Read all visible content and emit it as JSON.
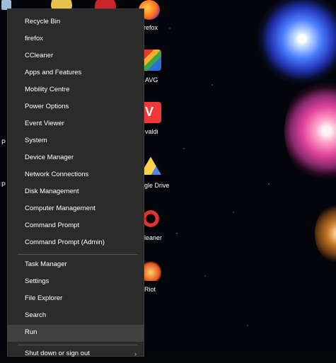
{
  "desktop": {
    "icons": [
      {
        "name": "recycle-bin-icon",
        "label": ""
      },
      {
        "name": "firefox-icon",
        "label": "refox"
      },
      {
        "name": "avg-icon",
        "label": "AVG"
      },
      {
        "name": "vivaldi-icon",
        "label": "valdi"
      },
      {
        "name": "google-drive-icon",
        "label": "gle Drive"
      },
      {
        "name": "ccleaner-icon",
        "label": "leaner"
      },
      {
        "name": "riot-icon",
        "label": "Riot"
      }
    ],
    "left_edge_fragments": [
      "P",
      "P"
    ]
  },
  "menu": {
    "items": [
      {
        "label": "Recycle Bin"
      },
      {
        "label": "firefox"
      },
      {
        "label": "CCleaner"
      },
      {
        "label": "Apps and Features"
      },
      {
        "label": "Mobility Centre"
      },
      {
        "label": "Power Options"
      },
      {
        "label": "Event Viewer"
      },
      {
        "label": "System"
      },
      {
        "label": "Device Manager"
      },
      {
        "label": "Network Connections"
      },
      {
        "label": "Disk Management"
      },
      {
        "label": "Computer Management"
      },
      {
        "label": "Command Prompt"
      },
      {
        "label": "Command Prompt (Admin)"
      }
    ],
    "items_2": [
      {
        "label": "Task Manager"
      },
      {
        "label": "Settings"
      },
      {
        "label": "File Explorer"
      },
      {
        "label": "Search"
      },
      {
        "label": "Run"
      }
    ],
    "partial_item": {
      "label": "Shut down or sign out",
      "chevron": "›"
    }
  }
}
